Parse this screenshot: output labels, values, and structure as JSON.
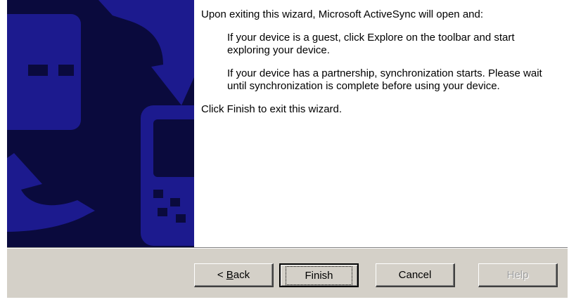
{
  "dialog": {
    "intro": "Upon exiting this wizard, Microsoft ActiveSync will open and:",
    "guest_note": "If your device is a guest, click Explore on the toolbar and start exploring your device.",
    "partnership_note": "If your device has a partnership, synchronization starts. Please wait until synchronization is complete before using your device.",
    "finish_note": "Click Finish to exit this wizard."
  },
  "buttons": {
    "back_prefix": "< ",
    "back_mnemonic": "B",
    "back_rest": "ack",
    "finish": "Finish",
    "cancel": "Cancel",
    "help": "Help"
  },
  "colors": {
    "banner_bg": "#0a0a3d",
    "banner_shape": "#1c1a8e",
    "dialog_face": "#d4d0c8"
  }
}
